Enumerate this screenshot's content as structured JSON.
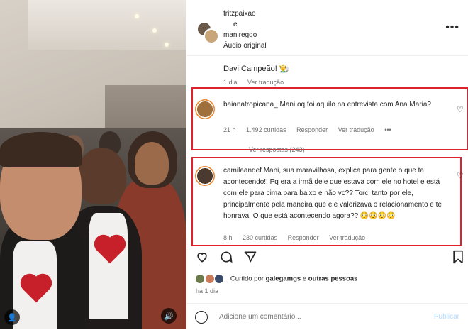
{
  "header": {
    "user1": "fritzpaixao",
    "connector": "e",
    "user2": "manireggo",
    "audio": "Áudio original",
    "more_icon": "more-horizontal-icon"
  },
  "caption": {
    "text": "Davi Campeão! 👨‍🌾",
    "time": "1 dia",
    "translate": "Ver tradução"
  },
  "comments": [
    {
      "username": "baianatropicana_",
      "text": "Mani oq foi aquilo na entrevista com Ana Maria?",
      "time": "21 h",
      "likes": "1.492 curtidas",
      "reply": "Responder",
      "translate": "Ver tradução",
      "more": "•••",
      "replies": "Ver respostas (243)"
    },
    {
      "username": "camilaandef",
      "text": "Mani, sua maravilhosa, explica para gente o que ta acontecendo!! Pq era a irmã dele que estava com ele no hotel e está com ele para cima para baixo e não vc?? Torci tanto por ele, principalmente pela maneira que ele valorizava o relacionamento e te honrava. O que está acontecendo agora?? 😳😳😳😳",
      "time": "8 h",
      "likes": "230 curtidas",
      "reply": "Responder",
      "translate": "Ver tradução"
    }
  ],
  "liked": {
    "prefix": "Curtido por ",
    "user": "galegamgs",
    "connector": " e ",
    "others": "outras pessoas"
  },
  "post_time": "há 1 dia",
  "comment_input": {
    "placeholder": "Adicione um comentário...",
    "publish": "Publicar"
  },
  "colors": {
    "highlight": "#e0202c",
    "secondary_text": "#737373",
    "publish_disabled": "#b3dbff"
  }
}
